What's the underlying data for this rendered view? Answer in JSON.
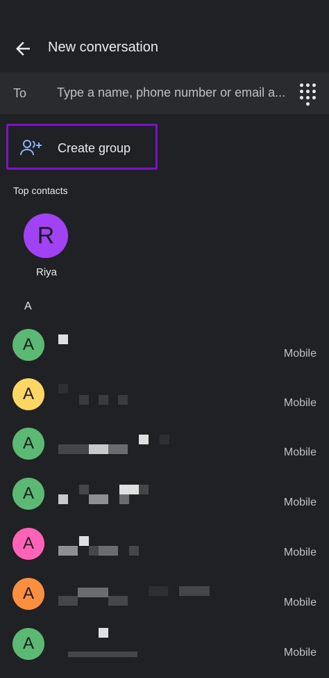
{
  "header": {
    "title": "New conversation"
  },
  "to_field": {
    "label": "To",
    "placeholder": "Type a name, phone number or email a..."
  },
  "create_group": {
    "label": "Create group"
  },
  "top_contacts": {
    "heading": "Top contacts",
    "items": [
      {
        "initial": "R",
        "name": "Riya",
        "color": "#a142f4"
      }
    ]
  },
  "contacts": {
    "section_letter": "A",
    "items": [
      {
        "initial": "A",
        "color": "#5bb974",
        "type": "Mobile"
      },
      {
        "initial": "A",
        "color": "#fdd663",
        "type": "Mobile"
      },
      {
        "initial": "A",
        "color": "#5bb974",
        "type": "Mobile"
      },
      {
        "initial": "A",
        "color": "#5bb974",
        "type": "Mobile"
      },
      {
        "initial": "A",
        "color": "#ff63b8",
        "type": "Mobile"
      },
      {
        "initial": "A",
        "color": "#fa903e",
        "type": "Mobile"
      },
      {
        "initial": "A",
        "color": "#5bb974",
        "type": "Mobile"
      }
    ]
  }
}
